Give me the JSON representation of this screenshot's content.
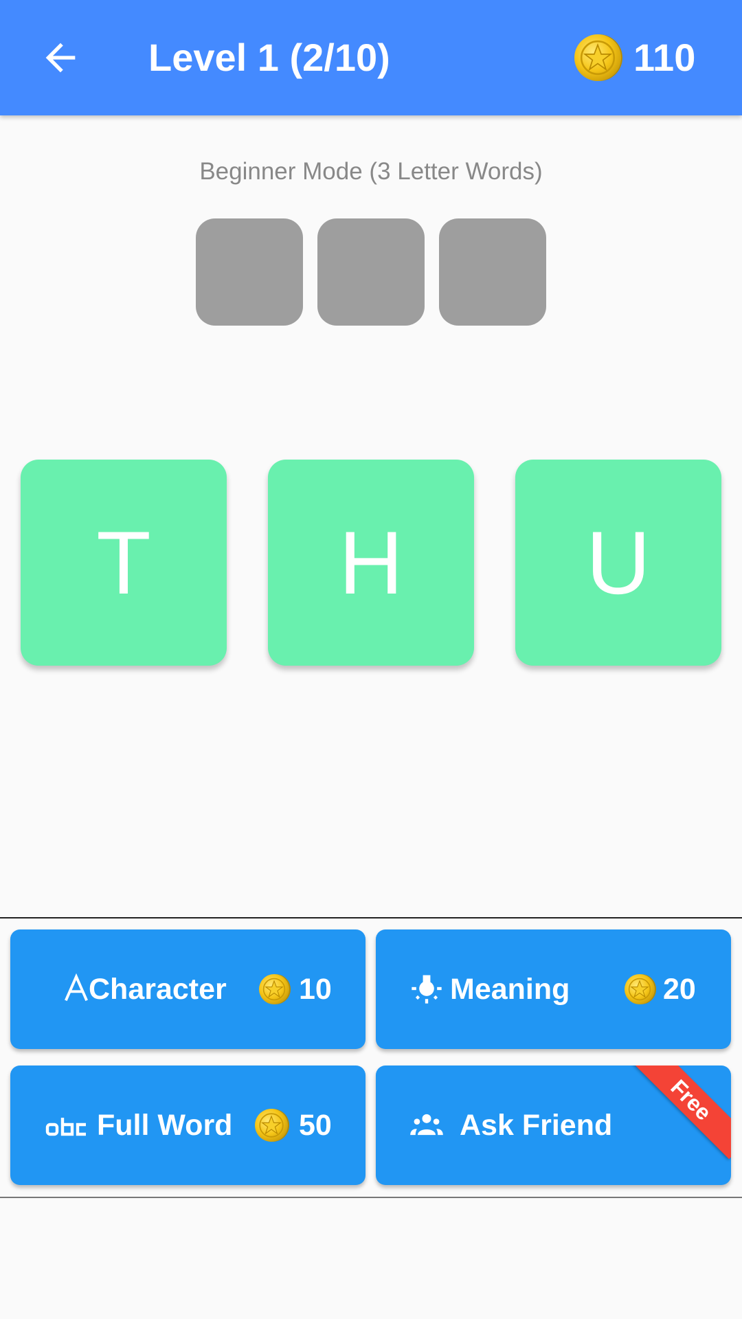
{
  "header": {
    "title": "Level 1 (2/10)",
    "coins": "110",
    "back_icon": "arrow-back-icon",
    "coin_icon": "gold-coin-icon",
    "background_color": "#448aff"
  },
  "game": {
    "mode_label": "Beginner Mode (3 Letter Words)",
    "answer_slots": [
      "",
      "",
      ""
    ],
    "letter_tiles": [
      "T",
      "H",
      "U"
    ],
    "tile_color": "#69f0ae",
    "slot_color": "#9e9e9e"
  },
  "hints": [
    {
      "label": "Character",
      "icon": "letter-a-icon",
      "cost": "10"
    },
    {
      "label": "Meaning",
      "icon": "lightbulb-icon",
      "cost": "20"
    },
    {
      "label": "Full Word",
      "icon": "abc-icon",
      "cost": "50"
    },
    {
      "label": "Ask Friend",
      "icon": "people-icon",
      "badge": "Free"
    }
  ],
  "colors": {
    "button": "#2196f3",
    "badge": "#f44336"
  }
}
